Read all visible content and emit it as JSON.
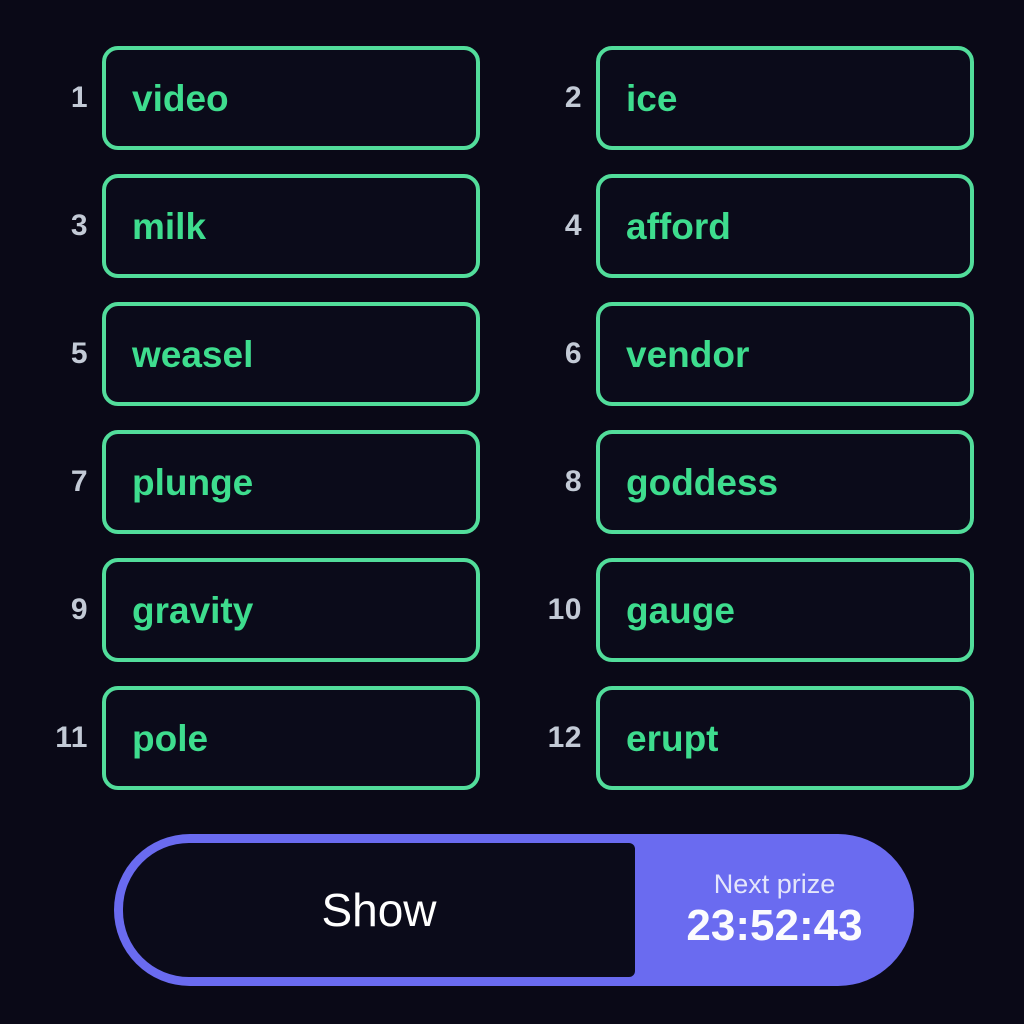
{
  "theme": {
    "background": "#0a0917",
    "box_border": "#52dd9b",
    "box_fill": "#0b0b1a",
    "word_text": "#3edd8e",
    "index_text": "#c3cad6",
    "accent_purple": "#6a6bf0",
    "button_fill": "#0b0b1a",
    "button_text": "#ffffff"
  },
  "words": [
    {
      "index": "1",
      "word": "video"
    },
    {
      "index": "2",
      "word": "ice"
    },
    {
      "index": "3",
      "word": "milk"
    },
    {
      "index": "4",
      "word": "afford"
    },
    {
      "index": "5",
      "word": "weasel"
    },
    {
      "index": "6",
      "word": "vendor"
    },
    {
      "index": "7",
      "word": "plunge"
    },
    {
      "index": "8",
      "word": "goddess"
    },
    {
      "index": "9",
      "word": "gravity"
    },
    {
      "index": "10",
      "word": "gauge"
    },
    {
      "index": "11",
      "word": "pole"
    },
    {
      "index": "12",
      "word": "erupt"
    }
  ],
  "action_bar": {
    "show_label": "Show",
    "prize_label": "Next prize",
    "prize_timer": "23:52:43"
  }
}
